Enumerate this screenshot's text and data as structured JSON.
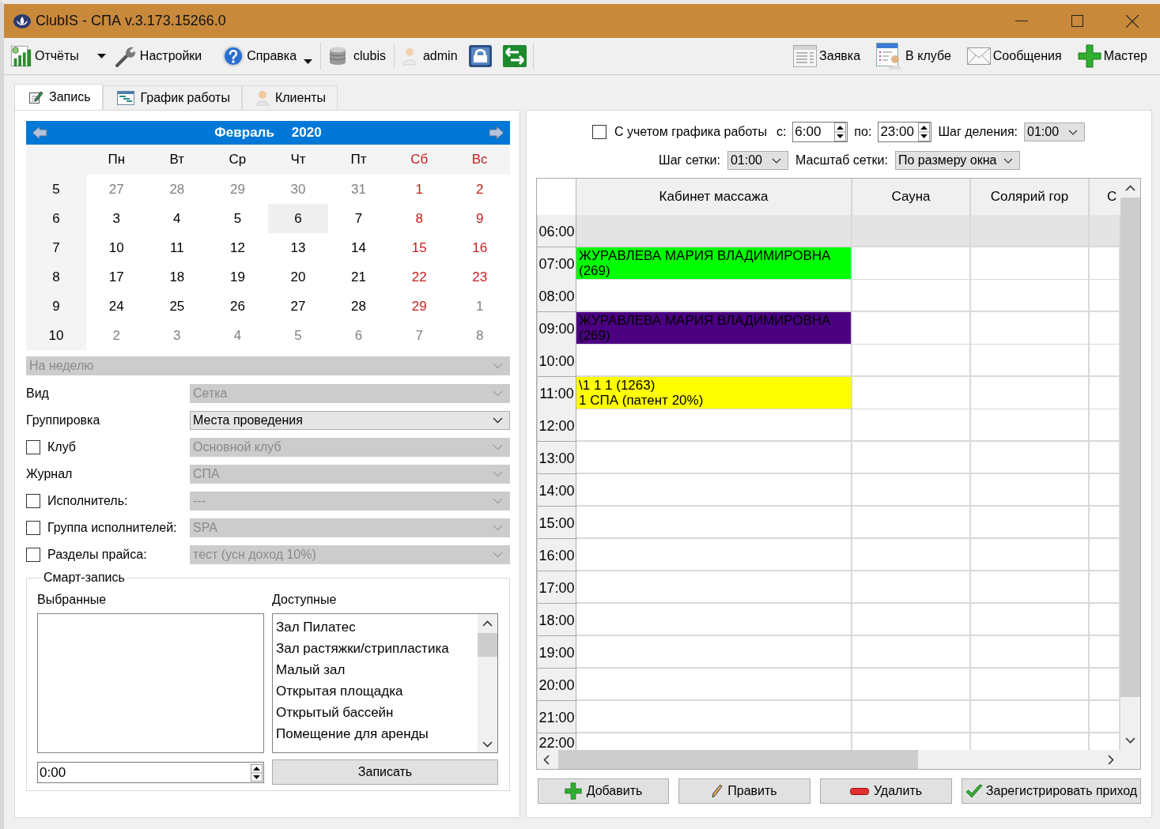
{
  "window": {
    "title": "ClubIS - СПА v.3.173.15266.0"
  },
  "toolbar": {
    "left": [
      {
        "label": "Отчёты",
        "dropdown": true
      },
      {
        "label": "Настройки",
        "dropdown": false
      },
      {
        "label": "Справка",
        "dropdown": true
      },
      {
        "label": "clubis",
        "dropdown": false
      },
      {
        "label": "admin",
        "dropdown": false
      }
    ],
    "right": [
      {
        "label": "Заявка"
      },
      {
        "label": "В клубе"
      },
      {
        "label": "Сообщения"
      },
      {
        "label": "Мастер"
      }
    ]
  },
  "tabs": [
    {
      "label": "Запись",
      "selected": true
    },
    {
      "label": "График работы",
      "selected": false
    },
    {
      "label": "Клиенты",
      "selected": false
    }
  ],
  "calendar": {
    "month": "Февраль",
    "year": "2020",
    "weekdays": [
      {
        "label": "Пн",
        "kind": "weekday"
      },
      {
        "label": "Вт",
        "kind": "weekday"
      },
      {
        "label": "Ср",
        "kind": "weekday"
      },
      {
        "label": "Чт",
        "kind": "weekday"
      },
      {
        "label": "Пт",
        "kind": "weekday"
      },
      {
        "label": "Сб",
        "kind": "weekend"
      },
      {
        "label": "Вс",
        "kind": "weekend"
      }
    ],
    "weeks": [
      {
        "number": "5",
        "days": [
          {
            "label": "27",
            "kind": "other",
            "selected": false
          },
          {
            "label": "28",
            "kind": "other",
            "selected": false
          },
          {
            "label": "29",
            "kind": "other",
            "selected": false
          },
          {
            "label": "30",
            "kind": "other",
            "selected": false
          },
          {
            "label": "31",
            "kind": "other",
            "selected": false
          },
          {
            "label": "1",
            "kind": "weekend",
            "selected": false
          },
          {
            "label": "2",
            "kind": "weekend",
            "selected": false
          }
        ]
      },
      {
        "number": "6",
        "days": [
          {
            "label": "3",
            "kind": "weekday",
            "selected": false
          },
          {
            "label": "4",
            "kind": "weekday",
            "selected": false
          },
          {
            "label": "5",
            "kind": "weekday",
            "selected": false
          },
          {
            "label": "6",
            "kind": "weekday",
            "selected": true
          },
          {
            "label": "7",
            "kind": "weekday",
            "selected": false
          },
          {
            "label": "8",
            "kind": "weekend",
            "selected": false
          },
          {
            "label": "9",
            "kind": "weekend",
            "selected": false
          }
        ]
      },
      {
        "number": "7",
        "days": [
          {
            "label": "10",
            "kind": "weekday",
            "selected": false
          },
          {
            "label": "11",
            "kind": "weekday",
            "selected": false
          },
          {
            "label": "12",
            "kind": "weekday",
            "selected": false
          },
          {
            "label": "13",
            "kind": "weekday",
            "selected": false
          },
          {
            "label": "14",
            "kind": "weekday",
            "selected": false
          },
          {
            "label": "15",
            "kind": "weekend",
            "selected": false
          },
          {
            "label": "16",
            "kind": "weekend",
            "selected": false
          }
        ]
      },
      {
        "number": "8",
        "days": [
          {
            "label": "17",
            "kind": "weekday",
            "selected": false
          },
          {
            "label": "18",
            "kind": "weekday",
            "selected": false
          },
          {
            "label": "19",
            "kind": "weekday",
            "selected": false
          },
          {
            "label": "20",
            "kind": "weekday",
            "selected": false
          },
          {
            "label": "21",
            "kind": "weekday",
            "selected": false
          },
          {
            "label": "22",
            "kind": "weekend",
            "selected": false
          },
          {
            "label": "23",
            "kind": "weekend",
            "selected": false
          }
        ]
      },
      {
        "number": "9",
        "days": [
          {
            "label": "24",
            "kind": "weekday",
            "selected": false
          },
          {
            "label": "25",
            "kind": "weekday",
            "selected": false
          },
          {
            "label": "26",
            "kind": "weekday",
            "selected": false
          },
          {
            "label": "27",
            "kind": "weekday",
            "selected": false
          },
          {
            "label": "28",
            "kind": "weekday",
            "selected": false
          },
          {
            "label": "29",
            "kind": "weekend",
            "selected": false
          },
          {
            "label": "1",
            "kind": "other",
            "selected": false
          }
        ]
      },
      {
        "number": "10",
        "days": [
          {
            "label": "2",
            "kind": "other",
            "selected": false
          },
          {
            "label": "3",
            "kind": "other",
            "selected": false
          },
          {
            "label": "4",
            "kind": "other",
            "selected": false
          },
          {
            "label": "5",
            "kind": "other",
            "selected": false
          },
          {
            "label": "6",
            "kind": "other",
            "selected": false
          },
          {
            "label": "7",
            "kind": "other",
            "selected": false
          },
          {
            "label": "8",
            "kind": "other",
            "selected": false
          }
        ]
      }
    ]
  },
  "period": {
    "value": "На неделю",
    "disabled": true
  },
  "filters": [
    {
      "kind": "label",
      "label": "Вид",
      "value": "Сетка",
      "disabled": true
    },
    {
      "kind": "label",
      "label": "Группировка",
      "value": "Места проведения",
      "disabled": false
    },
    {
      "kind": "checkbox",
      "label": "Клуб",
      "checked": false,
      "value": "Основной клуб",
      "disabled": true
    },
    {
      "kind": "label",
      "label": "Журнал",
      "value": "СПА",
      "disabled": true
    },
    {
      "kind": "checkbox",
      "label": "Исполнитель:",
      "checked": false,
      "value": "---",
      "disabled": true
    },
    {
      "kind": "checkbox",
      "label": "Группа исполнителей:",
      "checked": false,
      "value": "SPA",
      "disabled": true
    },
    {
      "kind": "checkbox",
      "label": "Разделы прайса:",
      "checked": false,
      "value": "тест (усн доход 10%)",
      "disabled": true
    }
  ],
  "smart_booking": {
    "title": "Смарт-запись",
    "selected_label": "Выбранные",
    "available_label": "Доступные",
    "available": [
      "Зал Пилатес",
      "Зал растяжки/стрипластика",
      "Малый зал",
      "Открытая площадка",
      "Открытый бассейн",
      "Помещение для аренды"
    ],
    "time": "0:00",
    "submit": "Записать"
  },
  "schedule_options": {
    "use_schedule": {
      "label": "С учетом графика работы",
      "checked": false
    },
    "from_label": "с:",
    "from": "6:00",
    "to_label": "по:",
    "to": "23:00",
    "division_label": "Шаг деления:",
    "division": "01:00",
    "grid_step_label": "Шаг сетки:",
    "grid_step": "01:00",
    "scale_label": "Масштаб сетки:",
    "scale": "По размеру окна"
  },
  "schedule": {
    "columns": [
      "Кабинет массажа",
      "Сауна",
      "Солярий гор",
      "С"
    ],
    "rows": [
      {
        "time": "06:00",
        "shaded": true
      },
      {
        "time": "07:00",
        "shaded": false,
        "booking": {
          "lines": [
            "ЖУРАВЛЕВА МАРИЯ ВЛАДИМИРОВНА",
            "(269)"
          ],
          "color": "#00ff00"
        }
      },
      {
        "time": "08:00",
        "shaded": false
      },
      {
        "time": "09:00",
        "shaded": false,
        "booking": {
          "lines": [
            "ЖУРАВЛЕВА МАРИЯ ВЛАДИМИРОВНА",
            "(269)"
          ],
          "color": "#4b0082"
        }
      },
      {
        "time": "10:00",
        "shaded": false
      },
      {
        "time": "11:00",
        "shaded": false,
        "booking": {
          "lines": [
            "\\1 1 1 (1263)",
            "1 СПА (патент 20%)"
          ],
          "color": "#ffff00"
        }
      },
      {
        "time": "12:00",
        "shaded": false
      },
      {
        "time": "13:00",
        "shaded": false
      },
      {
        "time": "14:00",
        "shaded": false
      },
      {
        "time": "15:00",
        "shaded": false
      },
      {
        "time": "16:00",
        "shaded": false
      },
      {
        "time": "17:00",
        "shaded": false
      },
      {
        "time": "18:00",
        "shaded": false
      },
      {
        "time": "19:00",
        "shaded": false
      },
      {
        "time": "20:00",
        "shaded": false
      },
      {
        "time": "21:00",
        "shaded": false
      },
      {
        "time": "22:00",
        "shaded": false
      }
    ]
  },
  "actions": [
    "Добавить",
    "Править",
    "Удалить",
    "Зарегистрировать приход"
  ]
}
